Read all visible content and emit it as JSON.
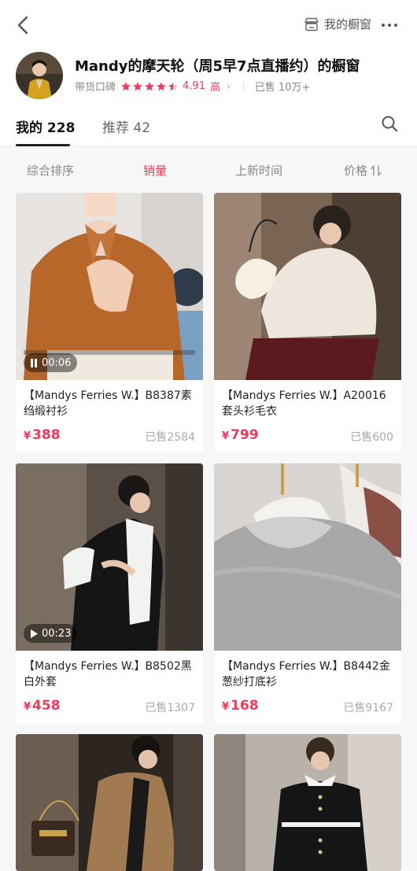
{
  "header": {
    "shop_link_label": "我的橱窗"
  },
  "profile": {
    "title": "Mandy的摩天轮（周5早7点直播约）的橱窗",
    "reputation_label": "带货口碑",
    "rating": "4.91",
    "rating_level": "高",
    "sold_label": "已售 10万+"
  },
  "tabs": [
    {
      "label": "我的 228"
    },
    {
      "label": "推荐 42"
    }
  ],
  "sort": [
    {
      "label": "综合排序"
    },
    {
      "label": "销量"
    },
    {
      "label": "上新时间"
    },
    {
      "label": "价格"
    }
  ],
  "products": [
    {
      "name": "【Mandys Ferries W.】B8387素绉缎衬衫",
      "currency": "¥",
      "price": "388",
      "sold": "已售2584",
      "video": "00:06"
    },
    {
      "name": "【Mandys Ferries W.】A20016套头衫毛衣",
      "currency": "¥",
      "price": "799",
      "sold": "已售600",
      "video": ""
    },
    {
      "name": "【Mandys Ferries W.】B8502黑白外套",
      "currency": "¥",
      "price": "458",
      "sold": "已售1307",
      "video": "00:23"
    },
    {
      "name": "【Mandys Ferries W.】B8442金葱纱打底衫",
      "currency": "¥",
      "price": "168",
      "sold": "已售9167",
      "video": ""
    }
  ],
  "colors": {
    "accent": "#ec3c5e",
    "background": "#f7f7f7"
  },
  "icons": {
    "back": "chevron-left-icon",
    "shop": "storefront-icon",
    "more": "more-dots-icon",
    "search": "search-icon",
    "sort_price": "sort-arrows-icon",
    "pause": "pause-icon",
    "play": "play-icon"
  }
}
